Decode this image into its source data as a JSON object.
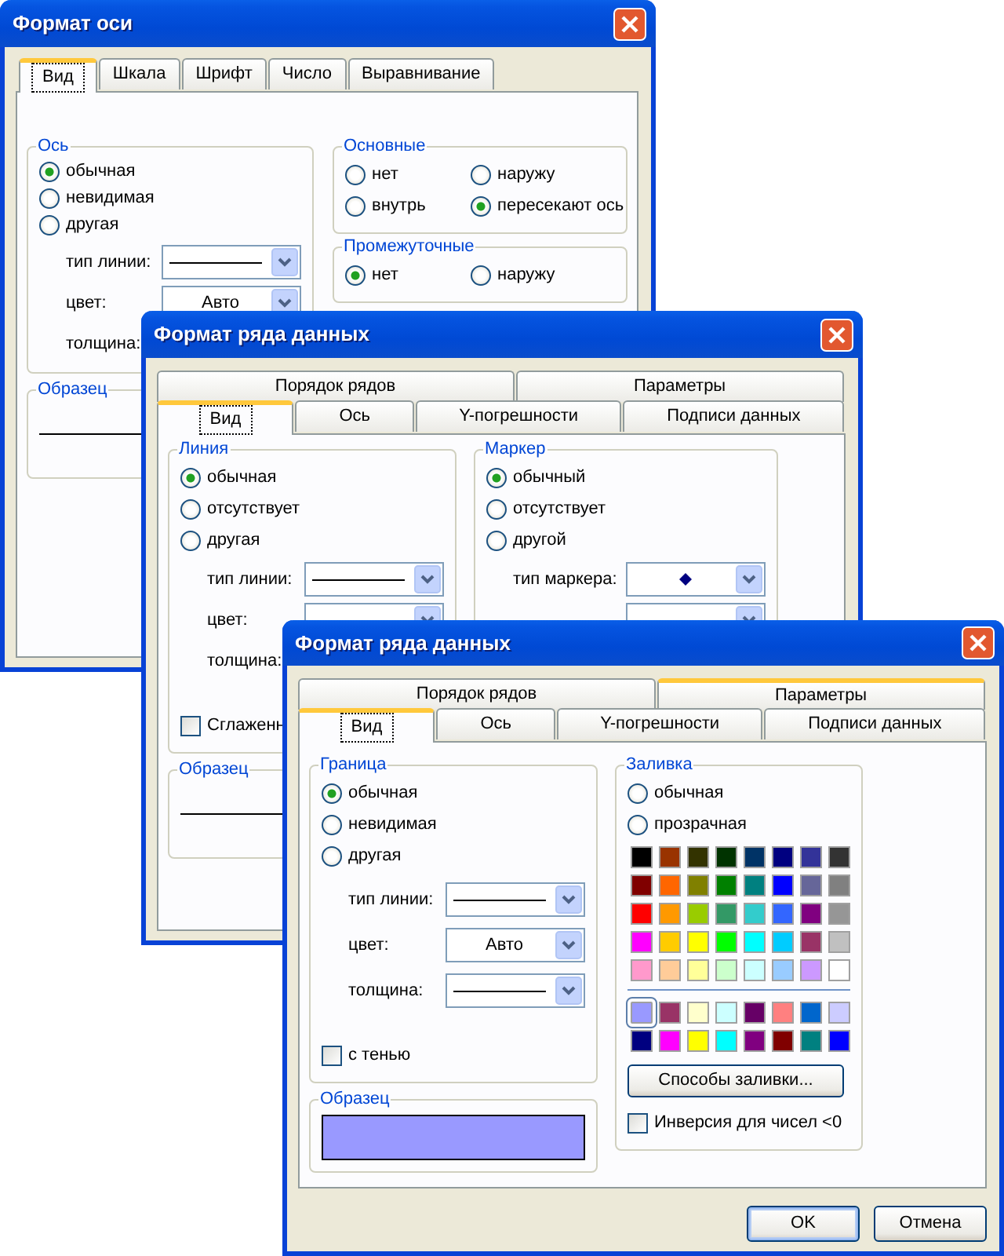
{
  "windows": [
    {
      "title": "Формат оси",
      "tab_rows": [
        [
          {
            "label": "Вид",
            "selected": true
          },
          {
            "label": "Шкала",
            "selected": false
          },
          {
            "label": "Шрифт",
            "selected": false
          },
          {
            "label": "Число",
            "selected": false
          },
          {
            "label": "Выравнивание",
            "selected": false
          }
        ]
      ],
      "columns": [
        [
          {
            "title": "Ось",
            "items": [
              {
                "kind": "radio",
                "label": "обычная",
                "selected": true
              },
              {
                "kind": "radio",
                "label": "невидимая",
                "selected": false
              },
              {
                "kind": "radio",
                "label": "другая",
                "selected": false
              },
              {
                "kind": "combo_line",
                "label": "тип линии:"
              },
              {
                "kind": "combo",
                "label": "цвет:",
                "value": "Авто"
              },
              {
                "kind": "field_label",
                "label": "толщина:"
              }
            ]
          },
          {
            "title": "Образец",
            "items": [
              {
                "kind": "line_sample"
              }
            ]
          }
        ],
        [
          {
            "title": "Основные",
            "items": [
              {
                "kind": "radio_grid",
                "options": [
                  {
                    "label": "нет",
                    "selected": false
                  },
                  {
                    "label": "наружу",
                    "selected": false
                  },
                  {
                    "label": "внутрь",
                    "selected": false
                  },
                  {
                    "label": "пересекают ось",
                    "selected": true
                  }
                ]
              }
            ]
          },
          {
            "title": "Промежуточные",
            "items": [
              {
                "kind": "radio_grid",
                "options": [
                  {
                    "label": "нет",
                    "selected": true
                  },
                  {
                    "label": "наружу",
                    "selected": false
                  }
                ]
              }
            ]
          }
        ]
      ]
    },
    {
      "title": "Формат ряда данных",
      "tab_rows": [
        [
          {
            "label": "Порядок рядов",
            "selected": false
          },
          {
            "label": "Параметры",
            "selected": false
          }
        ],
        [
          {
            "label": "Вид",
            "selected": true
          },
          {
            "label": "Ось",
            "selected": false
          },
          {
            "label": "Y-погрешности",
            "selected": false
          },
          {
            "label": "Подписи данных",
            "selected": false
          }
        ]
      ],
      "columns": [
        [
          {
            "title": "Линия",
            "items": [
              {
                "kind": "radio",
                "label": "обычная",
                "selected": true
              },
              {
                "kind": "radio",
                "label": "отсутствует",
                "selected": false
              },
              {
                "kind": "radio",
                "label": "другая",
                "selected": false
              },
              {
                "kind": "combo_line",
                "label": "тип линии:"
              },
              {
                "kind": "combo",
                "label": "цвет:"
              },
              {
                "kind": "field_label",
                "label": "толщина:"
              },
              {
                "kind": "checkbox",
                "label": "Сглаженн",
                "checked": false
              }
            ]
          },
          {
            "title": "Образец",
            "items": [
              {
                "kind": "line_sample"
              }
            ]
          }
        ],
        [
          {
            "title": "Маркер",
            "items": [
              {
                "kind": "radio",
                "label": "обычный",
                "selected": true
              },
              {
                "kind": "radio",
                "label": "отсутствует",
                "selected": false
              },
              {
                "kind": "radio",
                "label": "другой",
                "selected": false
              },
              {
                "kind": "combo_marker",
                "label": "тип маркера:"
              },
              {
                "kind": "combo"
              }
            ]
          }
        ]
      ]
    },
    {
      "title": "Формат ряда данных",
      "tab_rows": [
        [
          {
            "label": "Порядок рядов",
            "selected": false,
            "hover": false
          },
          {
            "label": "Параметры",
            "selected": false,
            "hover": true
          }
        ],
        [
          {
            "label": "Вид",
            "selected": true,
            "hover": false
          },
          {
            "label": "Ось",
            "selected": false,
            "hover": false
          },
          {
            "label": "Y-погрешности",
            "selected": false,
            "hover": false
          },
          {
            "label": "Подписи данных",
            "selected": false,
            "hover": false
          }
        ]
      ],
      "columns": [
        [
          {
            "title": "Граница",
            "items": [
              {
                "kind": "radio",
                "label": "обычная",
                "selected": true
              },
              {
                "kind": "radio",
                "label": "невидимая",
                "selected": false
              },
              {
                "kind": "radio",
                "label": "другая",
                "selected": false
              },
              {
                "kind": "combo_line",
                "label": "тип линии:"
              },
              {
                "kind": "combo",
                "label": "цвет:",
                "value": "Авто"
              },
              {
                "kind": "combo_line",
                "label": "толщина:"
              },
              {
                "kind": "checkbox",
                "label": "с тенью",
                "checked": false
              }
            ]
          },
          {
            "title": "Образец",
            "items": [
              {
                "kind": "fill_sample"
              }
            ]
          }
        ],
        [
          {
            "title": "Заливка",
            "items": [
              {
                "kind": "radio",
                "label": "обычная",
                "selected": false
              },
              {
                "kind": "radio",
                "label": "прозрачная",
                "selected": false
              },
              {
                "kind": "palette",
                "rows": [
                  [
                    {
                      "color": "#000000",
                      "selected": false
                    },
                    {
                      "color": "#993300",
                      "selected": false
                    },
                    {
                      "color": "#333300",
                      "selected": false
                    },
                    {
                      "color": "#003300",
                      "selected": false
                    },
                    {
                      "color": "#003366",
                      "selected": false
                    },
                    {
                      "color": "#000080",
                      "selected": false
                    },
                    {
                      "color": "#333399",
                      "selected": false
                    },
                    {
                      "color": "#333333",
                      "selected": false
                    }
                  ],
                  [
                    {
                      "color": "#800000",
                      "selected": false
                    },
                    {
                      "color": "#ff6600",
                      "selected": false
                    },
                    {
                      "color": "#808000",
                      "selected": false
                    },
                    {
                      "color": "#008000",
                      "selected": false
                    },
                    {
                      "color": "#008080",
                      "selected": false
                    },
                    {
                      "color": "#0000ff",
                      "selected": false
                    },
                    {
                      "color": "#666699",
                      "selected": false
                    },
                    {
                      "color": "#808080",
                      "selected": false
                    }
                  ],
                  [
                    {
                      "color": "#ff0000",
                      "selected": false
                    },
                    {
                      "color": "#ff9900",
                      "selected": false
                    },
                    {
                      "color": "#99cc00",
                      "selected": false
                    },
                    {
                      "color": "#339966",
                      "selected": false
                    },
                    {
                      "color": "#33cccc",
                      "selected": false
                    },
                    {
                      "color": "#3366ff",
                      "selected": false
                    },
                    {
                      "color": "#800080",
                      "selected": false
                    },
                    {
                      "color": "#969696",
                      "selected": false
                    }
                  ],
                  [
                    {
                      "color": "#ff00ff",
                      "selected": false
                    },
                    {
                      "color": "#ffcc00",
                      "selected": false
                    },
                    {
                      "color": "#ffff00",
                      "selected": false
                    },
                    {
                      "color": "#00ff00",
                      "selected": false
                    },
                    {
                      "color": "#00ffff",
                      "selected": false
                    },
                    {
                      "color": "#00ccff",
                      "selected": false
                    },
                    {
                      "color": "#993366",
                      "selected": false
                    },
                    {
                      "color": "#c0c0c0",
                      "selected": false
                    }
                  ],
                  [
                    {
                      "color": "#ff99cc",
                      "selected": false
                    },
                    {
                      "color": "#ffcc99",
                      "selected": false
                    },
                    {
                      "color": "#ffff99",
                      "selected": false
                    },
                    {
                      "color": "#ccffcc",
                      "selected": false
                    },
                    {
                      "color": "#ccffff",
                      "selected": false
                    },
                    {
                      "color": "#99ccff",
                      "selected": false
                    },
                    {
                      "color": "#cc99ff",
                      "selected": false
                    },
                    {
                      "color": "#ffffff",
                      "selected": false
                    }
                  ]
                ],
                "extra_rows": [
                  [
                    {
                      "color": "#9999ff",
                      "selected": true
                    },
                    {
                      "color": "#993366",
                      "selected": false
                    },
                    {
                      "color": "#ffffcc",
                      "selected": false
                    },
                    {
                      "color": "#ccffff",
                      "selected": false
                    },
                    {
                      "color": "#660066",
                      "selected": false
                    },
                    {
                      "color": "#ff8080",
                      "selected": false
                    },
                    {
                      "color": "#0066cc",
                      "selected": false
                    },
                    {
                      "color": "#ccccff",
                      "selected": false
                    }
                  ],
                  [
                    {
                      "color": "#000080",
                      "selected": false
                    },
                    {
                      "color": "#ff00ff",
                      "selected": false
                    },
                    {
                      "color": "#ffff00",
                      "selected": false
                    },
                    {
                      "color": "#00ffff",
                      "selected": false
                    },
                    {
                      "color": "#800080",
                      "selected": false
                    },
                    {
                      "color": "#800000",
                      "selected": false
                    },
                    {
                      "color": "#008080",
                      "selected": false
                    },
                    {
                      "color": "#0000ff",
                      "selected": false
                    }
                  ]
                ]
              },
              {
                "kind": "button",
                "label": "Способы заливки..."
              },
              {
                "kind": "checkbox",
                "label": "Инверсия для чисел <0",
                "checked": false
              }
            ]
          }
        ]
      ],
      "buttons": [
        {
          "label": "OK",
          "default": true
        },
        {
          "label": "Отмена",
          "default": false
        }
      ]
    }
  ]
}
